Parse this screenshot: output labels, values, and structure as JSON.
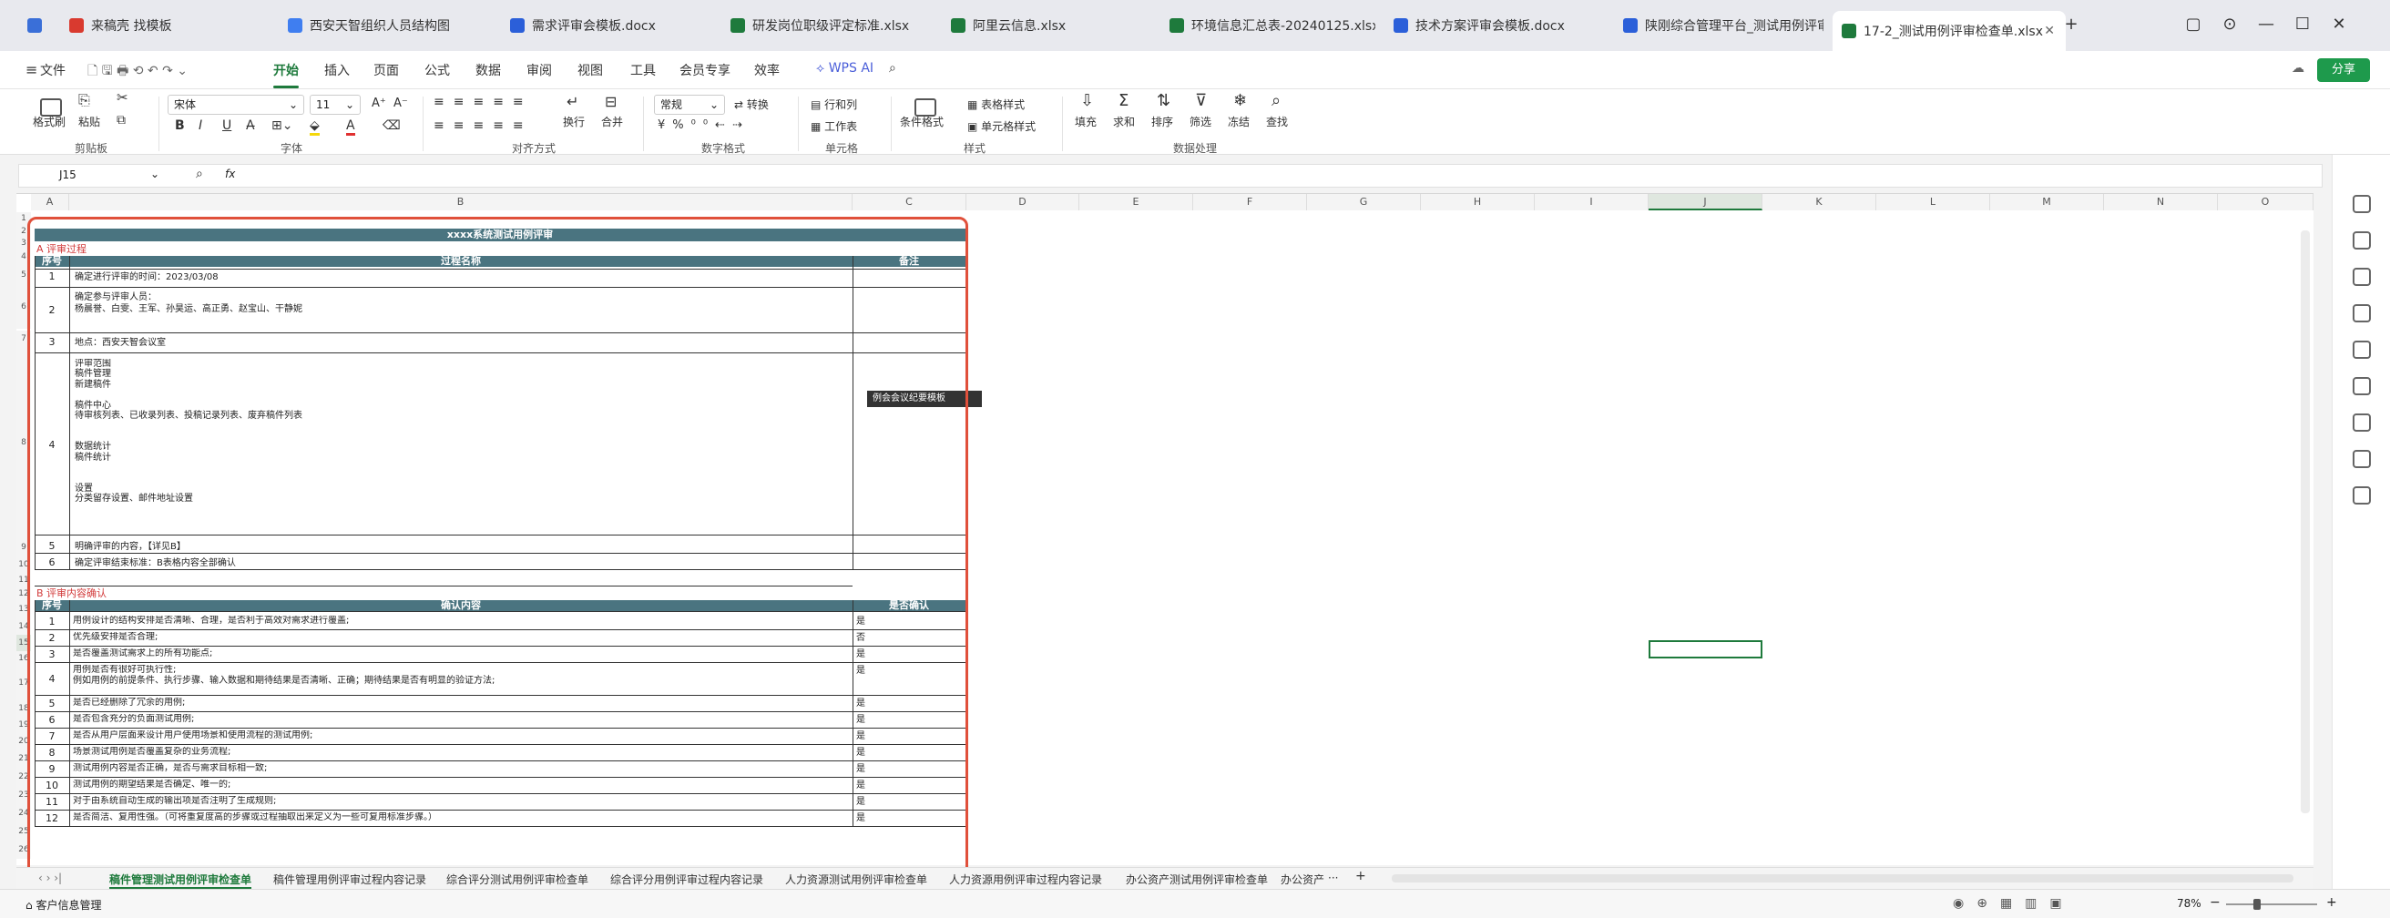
{
  "window": {
    "tabs": [
      {
        "label": "",
        "icon": "home-icon",
        "color": "#3a6fd8"
      },
      {
        "label": "来稿壳 找模板",
        "icon": "wps-logo-icon",
        "color": "#d93a2f"
      },
      {
        "label": "西安天智组织人员结构图",
        "icon": "diagram-icon",
        "color": "#3f7ef0"
      },
      {
        "label": "需求评审会模板.docx",
        "icon": "word-icon",
        "color": "#2b5fd9"
      },
      {
        "label": "研发岗位职级评定标准.xlsx",
        "icon": "excel-icon",
        "color": "#1e7a3c"
      },
      {
        "label": "阿里云信息.xlsx",
        "icon": "excel-icon",
        "color": "#1e7a3c"
      },
      {
        "label": "环境信息汇总表-20240125.xlsx",
        "icon": "excel-icon",
        "color": "#1e7a3c"
      },
      {
        "label": "技术方案评审会模板.docx",
        "icon": "word-icon",
        "color": "#2b5fd9"
      },
      {
        "label": "陕刚综合管理平台_测试用例评审报告",
        "icon": "word-icon",
        "color": "#2b5fd9"
      },
      {
        "label": "17-2_测试用例评审检查单.xlsx",
        "icon": "excel-icon",
        "color": "#1e7a3c",
        "active": true
      }
    ],
    "new_tab": "+",
    "controls": [
      "▢",
      "⊙",
      "—",
      "☐",
      "✕"
    ]
  },
  "menu": {
    "file": "文件",
    "items": [
      "开始",
      "插入",
      "页面",
      "公式",
      "数据",
      "审阅",
      "视图",
      "工具",
      "会员专享",
      "效率"
    ],
    "active": "开始",
    "wps_ai": "WPS AI",
    "share": "分享"
  },
  "ribbon": {
    "clipboard": {
      "group": "剪贴板",
      "format_painter": "格式刷",
      "paste": "粘贴"
    },
    "font": {
      "group": "字体",
      "name": "宋体",
      "size": "11"
    },
    "align": {
      "group": "对齐方式",
      "wrap": "换行",
      "merge": "合并"
    },
    "number": {
      "group": "数字格式",
      "format": "常规",
      "convert": "转换"
    },
    "cells": {
      "group": "单元格",
      "rowcol": "行和列",
      "sheet": "工作表"
    },
    "style": {
      "group": "样式",
      "conditional": "条件格式",
      "table_style": "表格样式",
      "cell_style": "单元格样式"
    },
    "data": {
      "group": "数据处理",
      "fill": "填充",
      "sum": "求和",
      "sort": "排序",
      "filter": "筛选",
      "freeze": "冻结",
      "find": "查找"
    }
  },
  "formula_bar": {
    "name_box": "J15",
    "fx": "fx",
    "value": ""
  },
  "columns": [
    "A",
    "B",
    "C",
    "D",
    "E",
    "F",
    "G",
    "H",
    "I",
    "J",
    "K",
    "L",
    "M",
    "N",
    "O"
  ],
  "rows": [
    "1",
    "2",
    "3",
    "4",
    "5",
    "6",
    "7",
    "8",
    "9",
    "10",
    "11",
    "12",
    "13",
    "14",
    "15",
    "16",
    "17",
    "18",
    "19",
    "20",
    "21",
    "22",
    "23",
    "24",
    "25",
    "26"
  ],
  "sheet": {
    "title": "xxxx系统测试用例评审",
    "section_a": "A 评审过程",
    "header_a": {
      "no": "序号",
      "name": "过程名称",
      "remark": "备注"
    },
    "process": [
      {
        "no": "1",
        "text": "确定进行评审的时间：2023/03/08"
      },
      {
        "no": "2",
        "text": "确定参与评审人员：\n杨晨誉、白雯、王军、孙昊运、高正勇、赵宝山、干静妮"
      },
      {
        "no": "3",
        "text": "地点：西安天智会议室"
      },
      {
        "no": "4",
        "text": "评审范围\n稿件管理\n新建稿件\n\n稿件中心\n待审核列表、已收录列表、投稿记录列表、废弃稿件列表\n\n\n数据统计\n稿件统计\n\n\n设置\n分类留存设置、邮件地址设置"
      },
      {
        "no": "5",
        "text": "明确评审的内容，【详见B】"
      },
      {
        "no": "6",
        "text": "确定评审结束标准：B表格内容全部确认"
      }
    ],
    "tooltip": "例会会议纪要模板",
    "section_b": "B 评审内容确认",
    "header_b": {
      "no": "序号",
      "content": "确认内容",
      "confirm": "是否确认"
    },
    "checks": [
      {
        "no": "1",
        "text": "用例设计的结构安排是否清晰、合理，是否利于高效对需求进行覆盖;",
        "ok": "是"
      },
      {
        "no": "2",
        "text": "优先级安排是否合理;",
        "ok": "否"
      },
      {
        "no": "3",
        "text": "是否覆盖测试需求上的所有功能点;",
        "ok": "是"
      },
      {
        "no": "4",
        "text": "用例是否有很好可执行性;\n例如用例的前提条件、执行步骤、输入数据和期待结果是否清晰、正确；期待结果是否有明显的验证方法;",
        "ok": "是"
      },
      {
        "no": "5",
        "text": "是否已经删除了冗余的用例;",
        "ok": "是"
      },
      {
        "no": "6",
        "text": "是否包含充分的负面测试用例;",
        "ok": "是"
      },
      {
        "no": "7",
        "text": "是否从用户层面来设计用户使用场景和使用流程的测试用例;",
        "ok": "是"
      },
      {
        "no": "8",
        "text": "场景测试用例是否覆盖复杂的业务流程;",
        "ok": "是"
      },
      {
        "no": "9",
        "text": "测试用例内容是否正确，是否与需求目标相一致;",
        "ok": "是"
      },
      {
        "no": "10",
        "text": "测试用例的期望结果是否确定、唯一的;",
        "ok": "是"
      },
      {
        "no": "11",
        "text": "对于由系统自动生成的输出项是否注明了生成规则;",
        "ok": "是"
      },
      {
        "no": "12",
        "text": "是否简洁、复用性强。（可将重复度高的步骤或过程抽取出来定义为一些可复用标准步骤。）",
        "ok": "是"
      }
    ]
  },
  "sheet_tabs": [
    "稿件管理测试用例评审检查单",
    "稿件管理用例评审过程内容记录",
    "综合评分测试用例评审检查单",
    "综合评分用例评审过程内容记录",
    "人力资源测试用例评审检查单",
    "人力资源用例评审过程内容记录",
    "办公资产测试用例评审检查单",
    "办公资产"
  ],
  "sheet_tabs_more": "···",
  "status": {
    "left": "客户信息管理",
    "zoom": "78%"
  },
  "colors": {
    "accent": "#1e7a3c",
    "header": "#4a7480",
    "section_title": "#d23b3b",
    "highlight_frame": "#e0503b"
  }
}
